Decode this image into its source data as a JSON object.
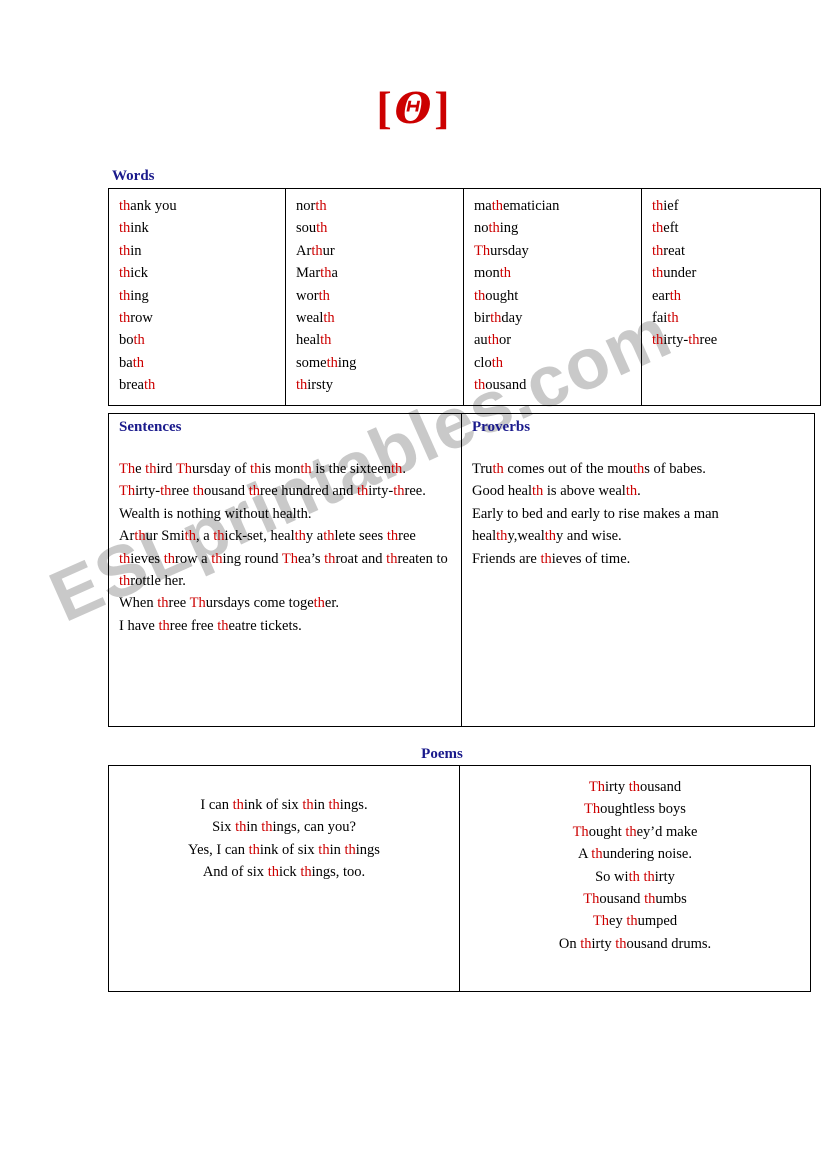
{
  "title": {
    "bracket_open": "[",
    "symbol": "Θ",
    "bracket_close": "]",
    "color": "#cc0000"
  },
  "colors": {
    "highlight_red": "#cc0000",
    "heading_blue": "#1a1a8c",
    "text_black": "#000000",
    "watermark_gray": "#c9c9c9",
    "border": "#000000"
  },
  "watermark": {
    "text": "ESLprintables.com"
  },
  "sections": {
    "words": {
      "heading": "Words",
      "columns": [
        [
          [
            [
              "th",
              "r"
            ],
            [
              "ank you",
              ""
            ]
          ],
          [
            [
              "th",
              "r"
            ],
            [
              "ink",
              ""
            ]
          ],
          [
            [
              "th",
              "r"
            ],
            [
              "in",
              ""
            ]
          ],
          [
            [
              "th",
              "r"
            ],
            [
              "ick",
              ""
            ]
          ],
          [
            [
              "th",
              "r"
            ],
            [
              "ing",
              ""
            ]
          ],
          [
            [
              "th",
              "r"
            ],
            [
              "row",
              ""
            ]
          ],
          [
            [
              "bo",
              ""
            ],
            [
              "th",
              "r"
            ]
          ],
          [
            [
              "ba",
              ""
            ],
            [
              "th",
              "r"
            ]
          ],
          [
            [
              "brea",
              ""
            ],
            [
              "th",
              "r"
            ]
          ]
        ],
        [
          [
            [
              "nor",
              ""
            ],
            [
              "th",
              "r"
            ]
          ],
          [
            [
              "sou",
              ""
            ],
            [
              "th",
              "r"
            ]
          ],
          [
            [
              "Ar",
              ""
            ],
            [
              "th",
              "r"
            ],
            [
              "ur",
              ""
            ]
          ],
          [
            [
              "Mar",
              ""
            ],
            [
              "th",
              "r"
            ],
            [
              "a",
              ""
            ]
          ],
          [
            [
              "wor",
              ""
            ],
            [
              "th",
              "r"
            ]
          ],
          [
            [
              "weal",
              ""
            ],
            [
              "th",
              "r"
            ]
          ],
          [
            [
              "heal",
              ""
            ],
            [
              "th",
              "r"
            ]
          ],
          [
            [
              "some",
              ""
            ],
            [
              "th",
              "r"
            ],
            [
              "ing",
              ""
            ]
          ],
          [
            [
              "th",
              "r"
            ],
            [
              "irsty",
              ""
            ]
          ]
        ],
        [
          [
            [
              "ma",
              ""
            ],
            [
              "th",
              "r"
            ],
            [
              "ematician",
              ""
            ]
          ],
          [
            [
              "no",
              ""
            ],
            [
              "th",
              "r"
            ],
            [
              "ing",
              ""
            ]
          ],
          [
            [
              "Th",
              "r"
            ],
            [
              "ursday",
              ""
            ]
          ],
          [
            [
              "mon",
              ""
            ],
            [
              "th",
              "r"
            ]
          ],
          [
            [
              "th",
              "r"
            ],
            [
              "ought",
              ""
            ]
          ],
          [
            [
              "bir",
              ""
            ],
            [
              "th",
              "r"
            ],
            [
              "day",
              ""
            ]
          ],
          [
            [
              "au",
              ""
            ],
            [
              "th",
              "r"
            ],
            [
              "or",
              ""
            ]
          ],
          [
            [
              "clo",
              ""
            ],
            [
              "th",
              "r"
            ]
          ],
          [
            [
              "th",
              "r"
            ],
            [
              "ousand",
              ""
            ]
          ]
        ],
        [
          [
            [
              "th",
              "r"
            ],
            [
              "ief",
              ""
            ]
          ],
          [
            [
              "th",
              "r"
            ],
            [
              "eft",
              ""
            ]
          ],
          [
            [
              "th",
              "r"
            ],
            [
              "reat",
              ""
            ]
          ],
          [
            [
              "th",
              "r"
            ],
            [
              "under",
              ""
            ]
          ],
          [
            [
              "ear",
              ""
            ],
            [
              "th",
              "r"
            ]
          ],
          [
            [
              "fai",
              ""
            ],
            [
              "th",
              "r"
            ]
          ],
          [
            [
              "th",
              "r"
            ],
            [
              "irty-",
              ""
            ],
            [
              "th",
              "r"
            ],
            [
              "ree",
              ""
            ]
          ]
        ]
      ]
    },
    "sentences": {
      "heading": "Sentences",
      "lines": [
        [
          [
            "Th",
            "r"
          ],
          [
            "e ",
            ""
          ],
          [
            "th",
            "r"
          ],
          [
            "ird ",
            ""
          ],
          [
            "Th",
            "r"
          ],
          [
            "ursday of ",
            ""
          ],
          [
            "th",
            "r"
          ],
          [
            "is mon",
            ""
          ],
          [
            "th",
            "r"
          ],
          [
            " is the sixteen",
            ""
          ],
          [
            "th",
            "r"
          ],
          [
            ".",
            ""
          ]
        ],
        [
          [
            "Th",
            "r"
          ],
          [
            "irty-",
            ""
          ],
          [
            "th",
            "r"
          ],
          [
            "ree ",
            ""
          ],
          [
            "th",
            "r"
          ],
          [
            "ousand ",
            ""
          ],
          [
            "th",
            "r"
          ],
          [
            "ree hundred and ",
            ""
          ],
          [
            "th",
            "r"
          ],
          [
            "irty-",
            ""
          ],
          [
            "th",
            "r"
          ],
          [
            "ree.",
            ""
          ]
        ],
        [
          [
            "Wealth is nothing without health.",
            ""
          ]
        ],
        [
          [
            "Ar",
            ""
          ],
          [
            "th",
            "r"
          ],
          [
            "ur Smi",
            ""
          ],
          [
            "th",
            "r"
          ],
          [
            ", a ",
            ""
          ],
          [
            "th",
            "r"
          ],
          [
            "ick-set, heal",
            ""
          ],
          [
            "th",
            "r"
          ],
          [
            "y a",
            ""
          ],
          [
            "th",
            "r"
          ],
          [
            "lete sees ",
            ""
          ],
          [
            "th",
            "r"
          ],
          [
            "ree ",
            ""
          ],
          [
            "th",
            "r"
          ],
          [
            "ieves ",
            ""
          ],
          [
            "th",
            "r"
          ],
          [
            "row a ",
            ""
          ],
          [
            "th",
            "r"
          ],
          [
            "ing round ",
            ""
          ],
          [
            "Th",
            "r"
          ],
          [
            "ea’s  ",
            ""
          ],
          [
            "th",
            "r"
          ],
          [
            "roat and ",
            ""
          ],
          [
            "th",
            "r"
          ],
          [
            "reaten to ",
            ""
          ],
          [
            "th",
            "r"
          ],
          [
            "rottle her.",
            ""
          ]
        ],
        [
          [
            "When ",
            ""
          ],
          [
            "th",
            "r"
          ],
          [
            "ree ",
            ""
          ],
          [
            "Th",
            "r"
          ],
          [
            "ursdays come toge",
            ""
          ],
          [
            "th",
            "r"
          ],
          [
            "er.",
            ""
          ]
        ],
        [
          [
            "I have ",
            ""
          ],
          [
            "th",
            "r"
          ],
          [
            "ree free ",
            ""
          ],
          [
            "th",
            "r"
          ],
          [
            "eatre tickets.",
            ""
          ]
        ]
      ]
    },
    "proverbs": {
      "heading": "Proverbs",
      "lines": [
        [
          [
            "Tru",
            ""
          ],
          [
            "th",
            "r"
          ],
          [
            " comes out of the mou",
            ""
          ],
          [
            "th",
            "r"
          ],
          [
            "s of babes.",
            ""
          ]
        ],
        [
          [
            "Good heal",
            ""
          ],
          [
            "th",
            "r"
          ],
          [
            " is above weal",
            ""
          ],
          [
            "th",
            "r"
          ],
          [
            ".",
            ""
          ]
        ],
        [
          [
            "Early to bed and early to rise makes a man heal",
            ""
          ],
          [
            "th",
            "r"
          ],
          [
            "y,weal",
            ""
          ],
          [
            "th",
            "r"
          ],
          [
            "y and wise.",
            ""
          ]
        ],
        [
          [
            "Friends are ",
            ""
          ],
          [
            "th",
            "r"
          ],
          [
            "ieves of time.",
            ""
          ]
        ]
      ]
    },
    "poems": {
      "heading": "Poems",
      "left": [
        [
          [
            "I can ",
            ""
          ],
          [
            "th",
            "r"
          ],
          [
            "ink of six ",
            ""
          ],
          [
            "th",
            "r"
          ],
          [
            "in ",
            ""
          ],
          [
            "th",
            "r"
          ],
          [
            "ings.",
            ""
          ]
        ],
        [
          [
            "Six ",
            ""
          ],
          [
            "th",
            "r"
          ],
          [
            "in ",
            ""
          ],
          [
            "th",
            "r"
          ],
          [
            "ings, can you?",
            ""
          ]
        ],
        [
          [
            "Yes, I can ",
            ""
          ],
          [
            "th",
            "r"
          ],
          [
            "ink of six ",
            ""
          ],
          [
            "th",
            "r"
          ],
          [
            "in ",
            ""
          ],
          [
            "th",
            "r"
          ],
          [
            "ings",
            ""
          ]
        ],
        [
          [
            "And of six ",
            ""
          ],
          [
            "th",
            "r"
          ],
          [
            "ick ",
            ""
          ],
          [
            "th",
            "r"
          ],
          [
            "ings, too.",
            ""
          ]
        ]
      ],
      "right": [
        [
          [
            "Th",
            "r"
          ],
          [
            "irty ",
            ""
          ],
          [
            "th",
            "r"
          ],
          [
            "ousand",
            ""
          ]
        ],
        [
          [
            "Th",
            "r"
          ],
          [
            "oughtless boys",
            ""
          ]
        ],
        [
          [
            "Th",
            "r"
          ],
          [
            "ought ",
            ""
          ],
          [
            "th",
            "r"
          ],
          [
            "ey’d make",
            ""
          ]
        ],
        [
          [
            "A ",
            ""
          ],
          [
            "th",
            "r"
          ],
          [
            "undering noise.",
            ""
          ]
        ],
        [
          [
            "So wi",
            ""
          ],
          [
            "th",
            "r"
          ],
          [
            " ",
            ""
          ],
          [
            "th",
            "r"
          ],
          [
            "irty",
            ""
          ]
        ],
        [
          [
            "Th",
            "r"
          ],
          [
            "ousand ",
            ""
          ],
          [
            "th",
            "r"
          ],
          [
            "umbs",
            ""
          ]
        ],
        [
          [
            "Th",
            "r"
          ],
          [
            "ey ",
            ""
          ],
          [
            "th",
            "r"
          ],
          [
            "umped",
            ""
          ]
        ],
        [
          [
            "On ",
            ""
          ],
          [
            "th",
            "r"
          ],
          [
            "irty ",
            ""
          ],
          [
            "th",
            "r"
          ],
          [
            "ousand drums.",
            ""
          ]
        ]
      ]
    }
  }
}
